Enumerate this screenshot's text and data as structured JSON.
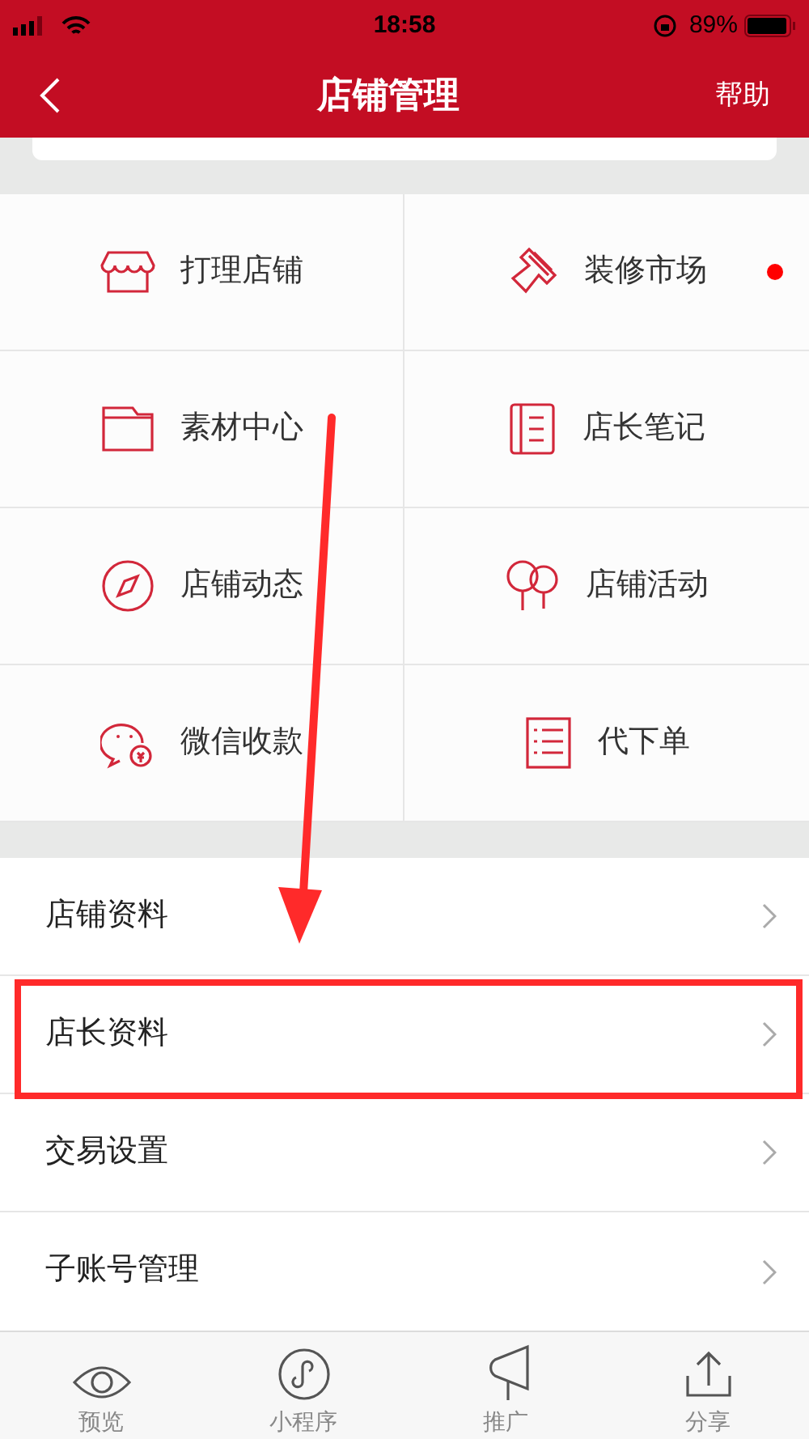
{
  "status_bar": {
    "time": "18:58",
    "battery": "89%"
  },
  "nav": {
    "title": "店铺管理",
    "action": "帮助"
  },
  "grid": [
    {
      "label": "打理店铺",
      "dot": false
    },
    {
      "label": "装修市场",
      "dot": true
    },
    {
      "label": "素材中心",
      "dot": false
    },
    {
      "label": "店长笔记",
      "dot": false
    },
    {
      "label": "店铺动态",
      "dot": false
    },
    {
      "label": "店铺活动",
      "dot": false
    },
    {
      "label": "微信收款",
      "dot": false
    },
    {
      "label": "代下单",
      "dot": false
    }
  ],
  "menu": [
    {
      "label": "店铺资料",
      "highlighted": false
    },
    {
      "label": "店长资料",
      "highlighted": true
    },
    {
      "label": "交易设置",
      "highlighted": false
    },
    {
      "label": "子账号管理",
      "highlighted": false
    }
  ],
  "tab_bar": [
    {
      "label": "预览"
    },
    {
      "label": "小程序"
    },
    {
      "label": "推广"
    },
    {
      "label": "分享"
    }
  ]
}
